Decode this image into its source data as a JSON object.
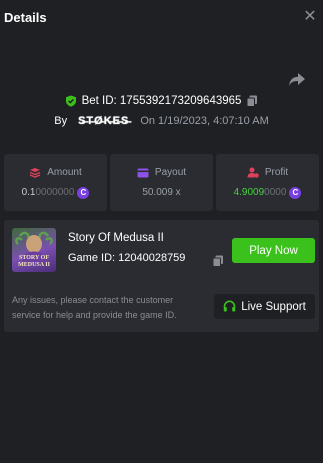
{
  "header": {
    "title": "Details"
  },
  "bet": {
    "id_label": "Bet ID: 1755392173209643965",
    "by_label": "By",
    "username": "S̶T̶Ø̶K̶E̶S̶",
    "date_text": "On 1/19/2023, 4:07:10 AM"
  },
  "stats": {
    "amount": {
      "label": "Amount",
      "value_main": "0.1",
      "value_tail": "0000000"
    },
    "payout": {
      "label": "Payout",
      "value": "50.009 x"
    },
    "profit": {
      "label": "Profit",
      "value_main": "4.9009",
      "value_tail": "0000"
    }
  },
  "game": {
    "name": "Story Of Medusa II",
    "id_label": "Game ID: 12040028759",
    "thumb_title_line1": "STORY OF",
    "thumb_title_line2": "MEDUSA II",
    "play_label": "Play Now"
  },
  "support": {
    "text": "Any issues, please contact the customer service for help and provide the game ID.",
    "button_label": "Live Support"
  },
  "colors": {
    "background": "#1e2024",
    "panel": "#2a2c31",
    "accent_green": "#3bc11c",
    "profit_green": "#44d43a",
    "coin_purple": "#7a3fe0",
    "amount_icon": "#e0405a"
  },
  "icons": {
    "close": "close-icon",
    "share": "share-icon",
    "shield": "shield-check-icon",
    "copy": "copy-icon",
    "amount": "stack-icon",
    "payout": "card-icon",
    "profit": "user-coin-icon",
    "coin": "coin-icon",
    "headset": "headset-icon"
  }
}
